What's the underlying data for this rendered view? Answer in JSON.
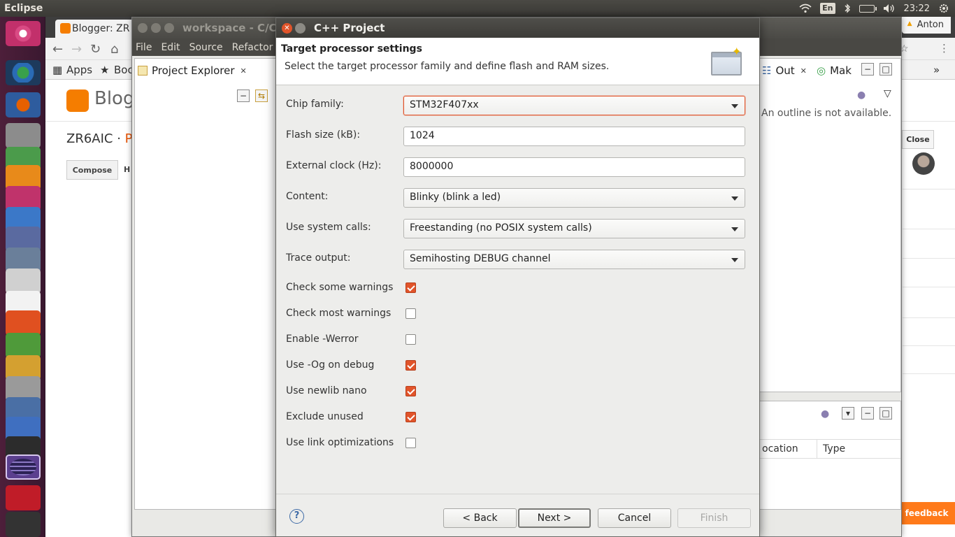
{
  "top_panel": {
    "app_name": "Eclipse",
    "language": "En",
    "clock": "23:22",
    "wifi_icon": "wifi-icon",
    "bluetooth_icon": "bluetooth-icon",
    "battery_icon": "battery-icon",
    "volume_icon": "volume-icon",
    "gear_icon": "gear-icon"
  },
  "browser": {
    "tab_title": "Blogger: ZR",
    "profile": "Anton",
    "bookmarks_apps": "Apps",
    "bookmarks_partial": "Boc",
    "blogger_word": "Blogg",
    "blog_name": "ZR6AIC · ",
    "blog_name_suffix": "Pc",
    "compose": "Compose",
    "html_partial": "H",
    "close": "Close",
    "feedback": "feedback"
  },
  "eclipse": {
    "title": "workspace - C/C++",
    "menu": [
      "File",
      "Edit",
      "Source",
      "Refactor"
    ],
    "project_explorer": "Project Explorer",
    "outline_tab": "Out",
    "make_tab": "Mak",
    "outline_message": "An outline is not available.",
    "col_location": "ocation",
    "col_type": "Type"
  },
  "dialog": {
    "title": "C++ Project",
    "header_title": "Target processor settings",
    "header_desc": "Select the target processor family and define flash and RAM sizes.",
    "fields": {
      "chip_family": {
        "label": "Chip family:",
        "value": "STM32F407xx"
      },
      "flash_size": {
        "label": "Flash size (kB):",
        "value": "1024"
      },
      "ext_clock": {
        "label": "External clock (Hz):",
        "value": "8000000"
      },
      "content": {
        "label": "Content:",
        "value": "Blinky (blink a led)"
      },
      "system_calls": {
        "label": "Use system calls:",
        "value": "Freestanding (no POSIX system calls)"
      },
      "trace_output": {
        "label": "Trace output:",
        "value": "Semihosting DEBUG channel"
      }
    },
    "checks": [
      {
        "label": "Check some warnings",
        "checked": true
      },
      {
        "label": "Check most warnings",
        "checked": false
      },
      {
        "label": "Enable -Werror",
        "checked": false
      },
      {
        "label": "Use -Og on debug",
        "checked": true
      },
      {
        "label": "Use newlib nano",
        "checked": true
      },
      {
        "label": "Exclude unused",
        "checked": true
      },
      {
        "label": "Use link optimizations",
        "checked": false
      }
    ],
    "buttons": {
      "help": "?",
      "back": "< Back",
      "next": "Next >",
      "cancel": "Cancel",
      "finish": "Finish"
    }
  }
}
